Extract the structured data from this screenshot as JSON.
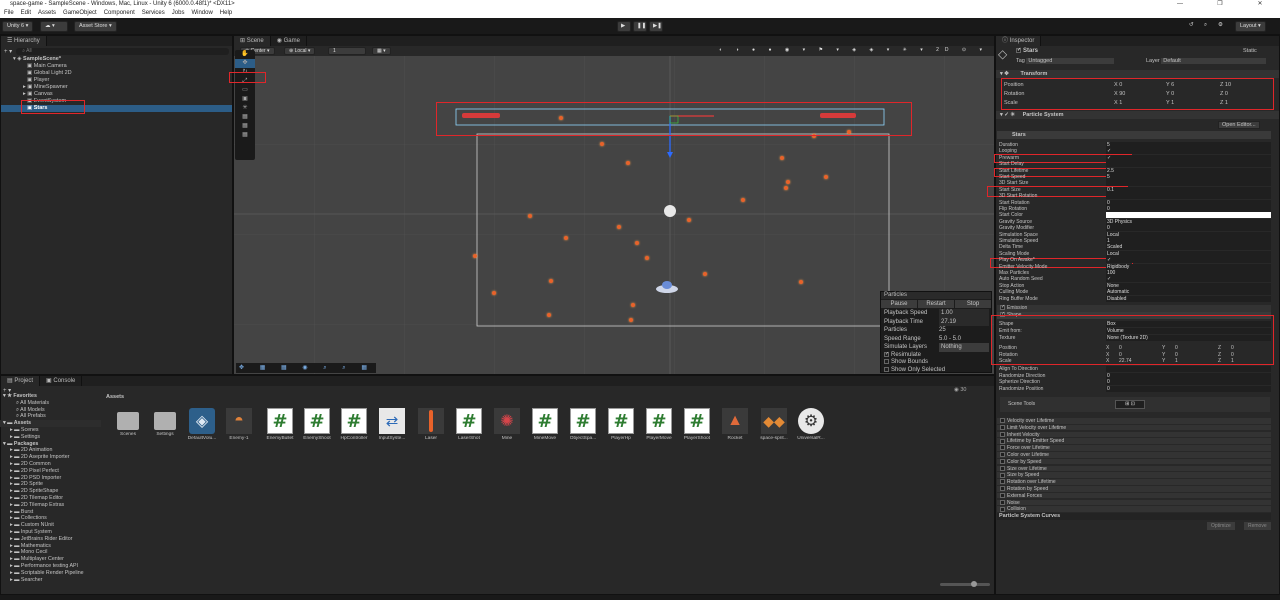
{
  "window": {
    "title": "space-game - SampleScene - Windows, Mac, Linux - Unity 6 (6000.0.48f1)* <DX11>",
    "controls": [
      "—",
      "❐",
      "✕"
    ]
  },
  "menu": [
    "File",
    "Edit",
    "Assets",
    "GameObject",
    "Component",
    "Services",
    "Jobs",
    "Window",
    "Help"
  ],
  "toolbar": {
    "account": "Unity 6",
    "asset_store": "Asset Store ▾",
    "layout": "Layout"
  },
  "hierarchy": {
    "tab": "Hierarchy",
    "search_placeholder": "All",
    "scene": "SampleScene*",
    "items": [
      "Main Camera",
      "Global Light 2D",
      "Player",
      "MineSpawner",
      "Canvas",
      "EventSystem",
      "Stars"
    ]
  },
  "scene": {
    "tabs": [
      "Scene",
      "Game"
    ],
    "pivot": "Center",
    "space": "Local",
    "grid_value": "1"
  },
  "particles_overlay": {
    "title": "Particles",
    "buttons": [
      "Pause",
      "Restart",
      "Stop"
    ],
    "rows": [
      {
        "label": "Playback Speed",
        "value": "1.00"
      },
      {
        "label": "Playback Time",
        "value": "27.19"
      },
      {
        "label": "Particles",
        "value": "25"
      },
      {
        "label": "Speed Range",
        "value": "5.0 - 5.0"
      },
      {
        "label": "Simulate Layers",
        "value": "Nothing"
      }
    ],
    "checks": [
      {
        "label": "Resimulate",
        "checked": true
      },
      {
        "label": "Show Bounds",
        "checked": false
      },
      {
        "label": "Show Only Selected",
        "checked": false
      }
    ]
  },
  "inspector": {
    "tab": "Inspector",
    "object_name": "Stars",
    "static_label": "Static",
    "tag_label": "Tag",
    "tag": "Untagged",
    "layer_label": "Layer",
    "layer": "Default",
    "transform": {
      "title": "Transform",
      "rows": [
        {
          "label": "Position",
          "x": "0",
          "y": "6",
          "z": "10"
        },
        {
          "label": "Rotation",
          "x": "90",
          "y": "0",
          "z": "0"
        },
        {
          "label": "Scale",
          "x": "1",
          "y": "1",
          "z": "1"
        }
      ]
    },
    "particle_system": {
      "title": "Particle System",
      "open_editor": "Open Editor...",
      "module_name": "Stars",
      "rows": [
        {
          "label": "Duration",
          "value": "5"
        },
        {
          "label": "Looping",
          "value": "✓"
        },
        {
          "label": "Prewarm",
          "value": "✓"
        },
        {
          "label": "Start Delay",
          "value": ""
        },
        {
          "label": "Start Lifetime",
          "value": "2.5"
        },
        {
          "label": "Start Speed",
          "value": "5"
        },
        {
          "label": "3D Start Size",
          "value": ""
        },
        {
          "label": "Start Size",
          "value": "0.1"
        },
        {
          "label": "3D Start Rotation",
          "value": ""
        },
        {
          "label": "Start Rotation",
          "value": "0"
        },
        {
          "label": "Flip Rotation",
          "value": "0"
        },
        {
          "label": "Start Color",
          "value": ""
        },
        {
          "label": "Gravity Source",
          "value": "3D Physics"
        },
        {
          "label": "Gravity Modifier",
          "value": "0"
        },
        {
          "label": "Simulation Space",
          "value": "Local"
        },
        {
          "label": "Simulation Speed",
          "value": "1"
        },
        {
          "label": "Delta Time",
          "value": "Scaled"
        },
        {
          "label": "Scaling Mode",
          "value": "Local"
        },
        {
          "label": "Play On Awake*",
          "value": "✓"
        },
        {
          "label": "Emitter Velocity Mode",
          "value": "Rigidbody"
        },
        {
          "label": "Max Particles",
          "value": "100"
        },
        {
          "label": "Auto Random Seed",
          "value": "✓"
        },
        {
          "label": "Stop Action",
          "value": "None"
        },
        {
          "label": "Culling Mode",
          "value": "Automatic"
        },
        {
          "label": "Ring Buffer Mode",
          "value": "Disabled"
        }
      ],
      "modules_top": [
        "Emission",
        "Shape"
      ],
      "shape_rows": [
        {
          "label": "Shape",
          "value": "Box"
        },
        {
          "label": "Emit from:",
          "value": "Volume"
        },
        {
          "label": "Texture",
          "value": "None (Texture 2D)"
        }
      ],
      "shape_vec": [
        {
          "label": "Position",
          "x": "0",
          "y": "0",
          "z": "0"
        },
        {
          "label": "Rotation",
          "x": "0",
          "y": "0",
          "z": "0"
        },
        {
          "label": "Scale",
          "x": "22.74",
          "y": "1",
          "z": "1"
        }
      ],
      "shape_more": [
        {
          "label": "Align To Direction",
          "value": ""
        },
        {
          "label": "Randomize Direction",
          "value": "0"
        },
        {
          "label": "Spherize Direction",
          "value": "0"
        },
        {
          "label": "Randomize Position",
          "value": "0"
        }
      ],
      "scene_tools": "Scene Tools",
      "modules_bottom": [
        "Velocity over Lifetime",
        "Limit Velocity over Lifetime",
        "Inherit Velocity",
        "Lifetime by Emitter Speed",
        "Force over Lifetime",
        "Color over Lifetime",
        "Color by Speed",
        "Size over Lifetime",
        "Size by Speed",
        "Rotation over Lifetime",
        "Rotation by Speed",
        "External Forces",
        "Noise",
        "Collision"
      ],
      "curves": "Particle System Curves",
      "optimize": "Optimize",
      "remove": "Remove"
    }
  },
  "project": {
    "tabs": [
      "Project",
      "Console"
    ],
    "favorites_title": "Favorites",
    "favorites": [
      "All Materials",
      "All Models",
      "All Prefabs"
    ],
    "assets_title": "Assets",
    "assets_children": [
      "Scenes",
      "Settings"
    ],
    "packages_title": "Packages",
    "packages": [
      "2D Animation",
      "2D Aseprite Importer",
      "2D Common",
      "2D Pixel Perfect",
      "2D PSD Importer",
      "2D Sprite",
      "2D SpriteShape",
      "2D Tilemap Editor",
      "2D Tilemap Extras",
      "Burst",
      "Collections",
      "Custom NUnit",
      "Input System",
      "JetBrains Rider Editor",
      "Mathematics",
      "Mono Cecil",
      "Multiplayer Center",
      "Performance testing API",
      "Scriptable Render Pipeline",
      "Searcher"
    ],
    "breadcrumb": "Assets",
    "count_label": "30",
    "asset_items": [
      {
        "name": "Scenes",
        "kind": "folder"
      },
      {
        "name": "Settings",
        "kind": "folder"
      },
      {
        "name": "DefaultVolu...",
        "kind": "cube"
      },
      {
        "name": "Enemy-1",
        "kind": "ship"
      },
      {
        "name": "EnemyBullet",
        "kind": "script"
      },
      {
        "name": "EnemyShoot",
        "kind": "script"
      },
      {
        "name": "HpController",
        "kind": "script"
      },
      {
        "name": "InputSyste...",
        "kind": "input"
      },
      {
        "name": "Laser",
        "kind": "laser"
      },
      {
        "name": "LaserShot",
        "kind": "script"
      },
      {
        "name": "Mine",
        "kind": "mine"
      },
      {
        "name": "MineMove",
        "kind": "script"
      },
      {
        "name": "ObjectSpa...",
        "kind": "script"
      },
      {
        "name": "PlayerHp",
        "kind": "script"
      },
      {
        "name": "PlayerMove",
        "kind": "script"
      },
      {
        "name": "PlayerShoot",
        "kind": "script"
      },
      {
        "name": "Rocket",
        "kind": "rocket"
      },
      {
        "name": "space-sprit...",
        "kind": "sprite"
      },
      {
        "name": "UniversalR...",
        "kind": "gear"
      }
    ]
  },
  "colors": {
    "highlight": "#e0262a",
    "selection": "#2c5d87",
    "particle": "#e8622a",
    "script_hash": "#2f7d32"
  }
}
